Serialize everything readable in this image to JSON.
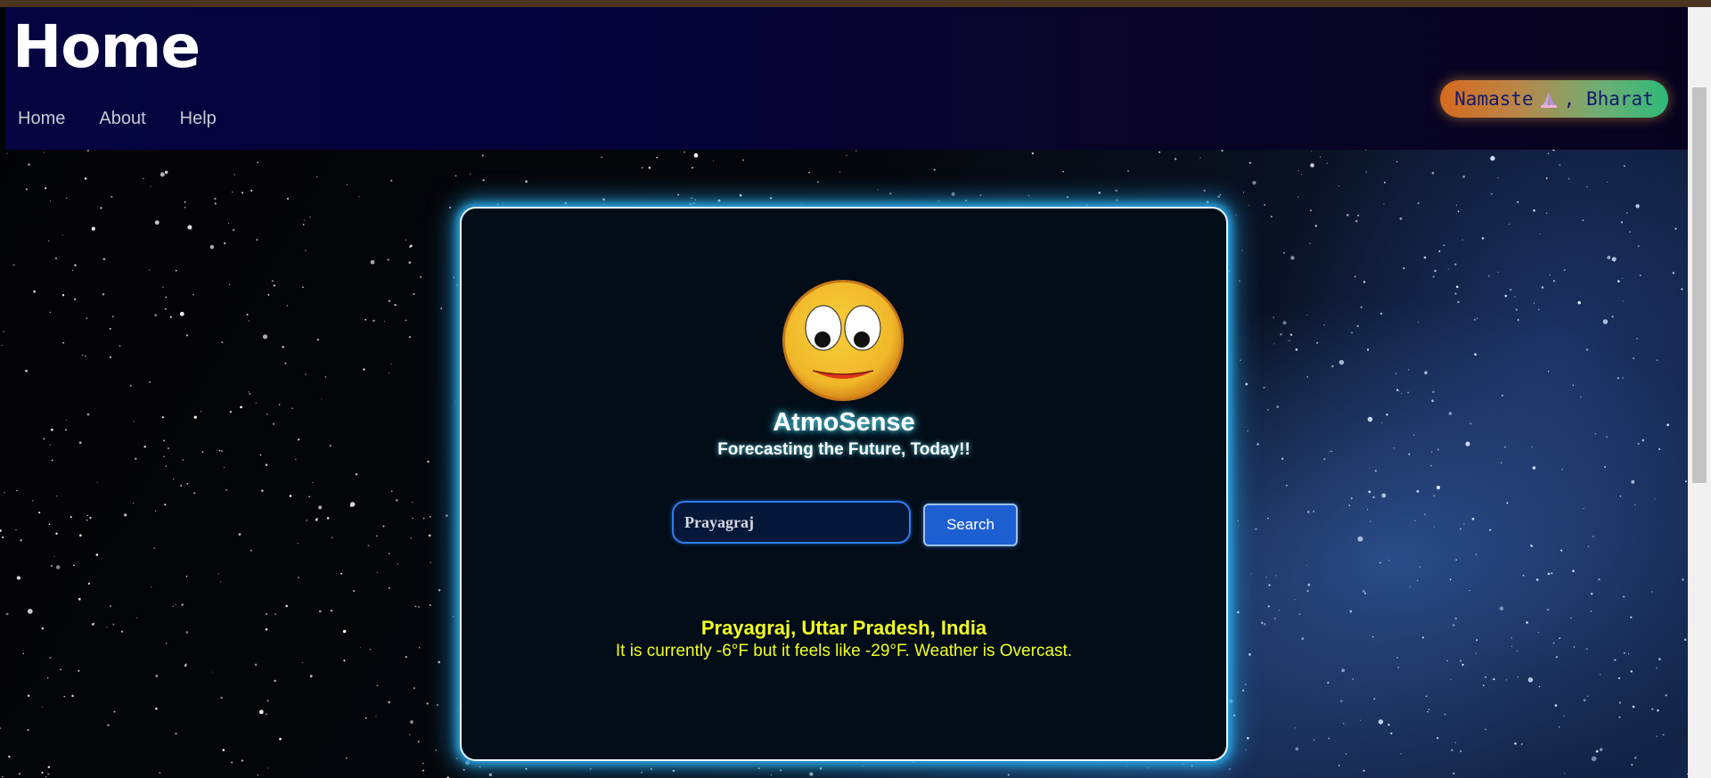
{
  "header": {
    "brand": "Home",
    "nav": [
      "Home",
      "About",
      "Help"
    ],
    "greeting": {
      "before": "Namaste",
      "icon": "namaste-icon",
      "after": ", Bharat"
    }
  },
  "app": {
    "title": "AtmoSense",
    "tagline": "Forecasting the Future, Today!!",
    "mascot_icon": "smiley-face-icon"
  },
  "search": {
    "value": "Prayagraj",
    "button_label": "Search"
  },
  "result": {
    "location": "Prayagraj, Uttar Pradesh, India",
    "details": "It is currently -6°F but it feels like -29°F. Weather is Overcast."
  },
  "colors": {
    "navbar": "#050440",
    "card_glow": "#2aa9e8",
    "result_text": "#f2ff1e",
    "search_button": "#1d5fd1"
  }
}
